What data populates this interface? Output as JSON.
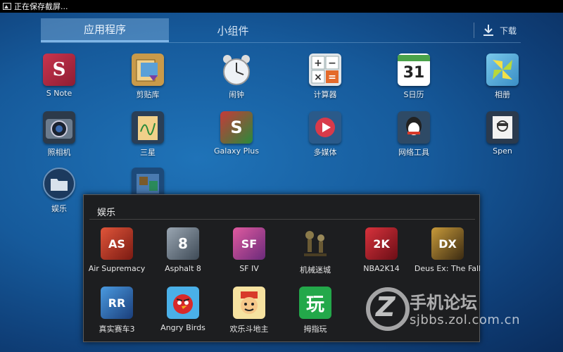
{
  "status_bar": {
    "text": "正在保存截屏..."
  },
  "tabs": {
    "apps": "应用程序",
    "widgets": "小组件",
    "download": "下载"
  },
  "apps": [
    {
      "label": "S Note",
      "glyph": "S",
      "icon": "s-note-icon"
    },
    {
      "label": "剪贴库",
      "glyph": "",
      "icon": "clipboard-icon"
    },
    {
      "label": "闹钟",
      "glyph": "",
      "icon": "alarm-clock-icon"
    },
    {
      "label": "计算器",
      "glyph": "+−×=",
      "icon": "calculator-icon"
    },
    {
      "label": "S日历",
      "glyph": "31",
      "icon": "calendar-icon"
    },
    {
      "label": "相册",
      "glyph": "",
      "icon": "gallery-icon"
    },
    {
      "label": "照相机",
      "glyph": "",
      "icon": "camera-icon"
    },
    {
      "label": "三星",
      "glyph": "",
      "icon": "samsung-folder-icon"
    },
    {
      "label": "Galaxy Plus",
      "glyph": "S",
      "icon": "galaxy-plus-icon"
    },
    {
      "label": "多媒体",
      "glyph": "",
      "icon": "multimedia-folder-icon"
    },
    {
      "label": "网络工具",
      "glyph": "",
      "icon": "network-tools-folder-icon"
    },
    {
      "label": "Spen",
      "glyph": "",
      "icon": "spen-folder-icon"
    },
    {
      "label": "娱乐",
      "glyph": "",
      "icon": "entertainment-folder-icon"
    },
    {
      "label": "",
      "glyph": "",
      "icon": "hidden-folder-icon"
    }
  ],
  "folder": {
    "title": "娱乐",
    "apps": [
      {
        "label": "Air Supremacy",
        "glyph": "AS",
        "icon": "air-supremacy-icon",
        "color": "#c8402a"
      },
      {
        "label": "Asphalt 8",
        "glyph": "8",
        "icon": "asphalt-8-icon",
        "color": "#6c7a8a"
      },
      {
        "label": "SF IV",
        "glyph": "SF",
        "icon": "sf-iv-icon",
        "color": "#b33a7a"
      },
      {
        "label": "机械迷城",
        "glyph": "",
        "icon": "machinarium-icon",
        "color": "#2a2a26"
      },
      {
        "label": "NBA2K14",
        "glyph": "2K",
        "icon": "nba2k14-icon",
        "color": "#b01e28"
      },
      {
        "label": "Deus Ex: The Fall",
        "glyph": "DX",
        "icon": "deus-ex-icon",
        "color": "#7a5a22"
      },
      {
        "label": "真实赛车3",
        "glyph": "RR",
        "icon": "real-racing-3-icon",
        "color": "#2a68b8"
      },
      {
        "label": "Angry Birds",
        "glyph": "",
        "icon": "angry-birds-icon",
        "color": "#3fa4e0"
      },
      {
        "label": "欢乐斗地主",
        "glyph": "",
        "icon": "happy-landlord-icon",
        "color": "#f2c11a"
      },
      {
        "label": "拇指玩",
        "glyph": "玩",
        "icon": "muzhiwan-icon",
        "color": "#23a84a"
      }
    ]
  },
  "watermark": {
    "line1": "手机论坛",
    "line2": "sjbbs.zol.com.cn"
  }
}
